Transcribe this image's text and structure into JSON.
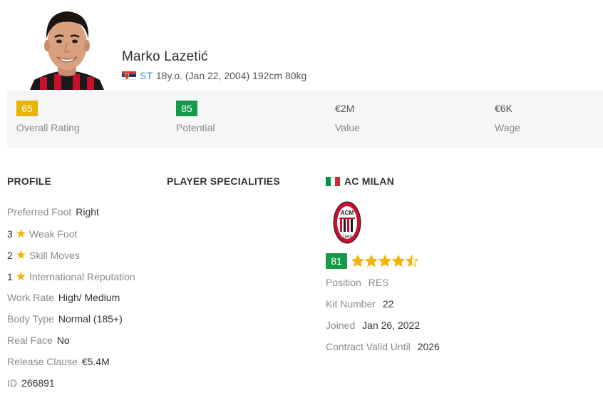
{
  "player": {
    "name": "Marko Lazetić",
    "position": "ST",
    "age_info": "18y.o. (Jan 22, 2004) 192cm 80kg",
    "nation_flag_icon": "serbia-flag-icon"
  },
  "stats": [
    {
      "value": "65",
      "label": "Overall Rating",
      "badge_color": "#e8b400"
    },
    {
      "value": "85",
      "label": "Potential",
      "badge_color": "#139b4a"
    },
    {
      "value": "€2M",
      "label": "Value"
    },
    {
      "value": "€6K",
      "label": "Wage"
    }
  ],
  "profile": {
    "heading": "PROFILE",
    "preferred_foot": {
      "label": "Preferred Foot",
      "value": "Right"
    },
    "weak_foot": {
      "num": "3",
      "label": "Weak Foot"
    },
    "skill_moves": {
      "num": "2",
      "label": "Skill Moves"
    },
    "intl_rep": {
      "num": "1",
      "label": "International Reputation"
    },
    "work_rate": {
      "label": "Work Rate",
      "value": "High/ Medium"
    },
    "body_type": {
      "label": "Body Type",
      "value": "Normal (185+)"
    },
    "real_face": {
      "label": "Real Face",
      "value": "No"
    },
    "release_clause": {
      "label": "Release Clause",
      "value": "€5.4M"
    },
    "id": {
      "label": "ID",
      "value": "266891"
    }
  },
  "specialities": {
    "heading": "PLAYER SPECIALITIES"
  },
  "club": {
    "heading": "AC MILAN",
    "flag_icon": "italy-flag-icon",
    "rating": "81",
    "rating_stars": 4.5,
    "position": {
      "label": "Position",
      "value": "RES"
    },
    "kit_number": {
      "label": "Kit Number",
      "value": "22"
    },
    "joined": {
      "label": "Joined",
      "value": "Jan 26, 2022"
    },
    "contract": {
      "label": "Contract Valid Until",
      "value": "2026"
    },
    "logo_text": {
      "top": "ACM",
      "year": "1899"
    }
  },
  "colors": {
    "badge_yellow": "#e8b400",
    "badge_green": "#139b4a",
    "link_blue": "#3d8fd1",
    "star": "#f5b400",
    "stats_bg": "#f5f6f8"
  }
}
